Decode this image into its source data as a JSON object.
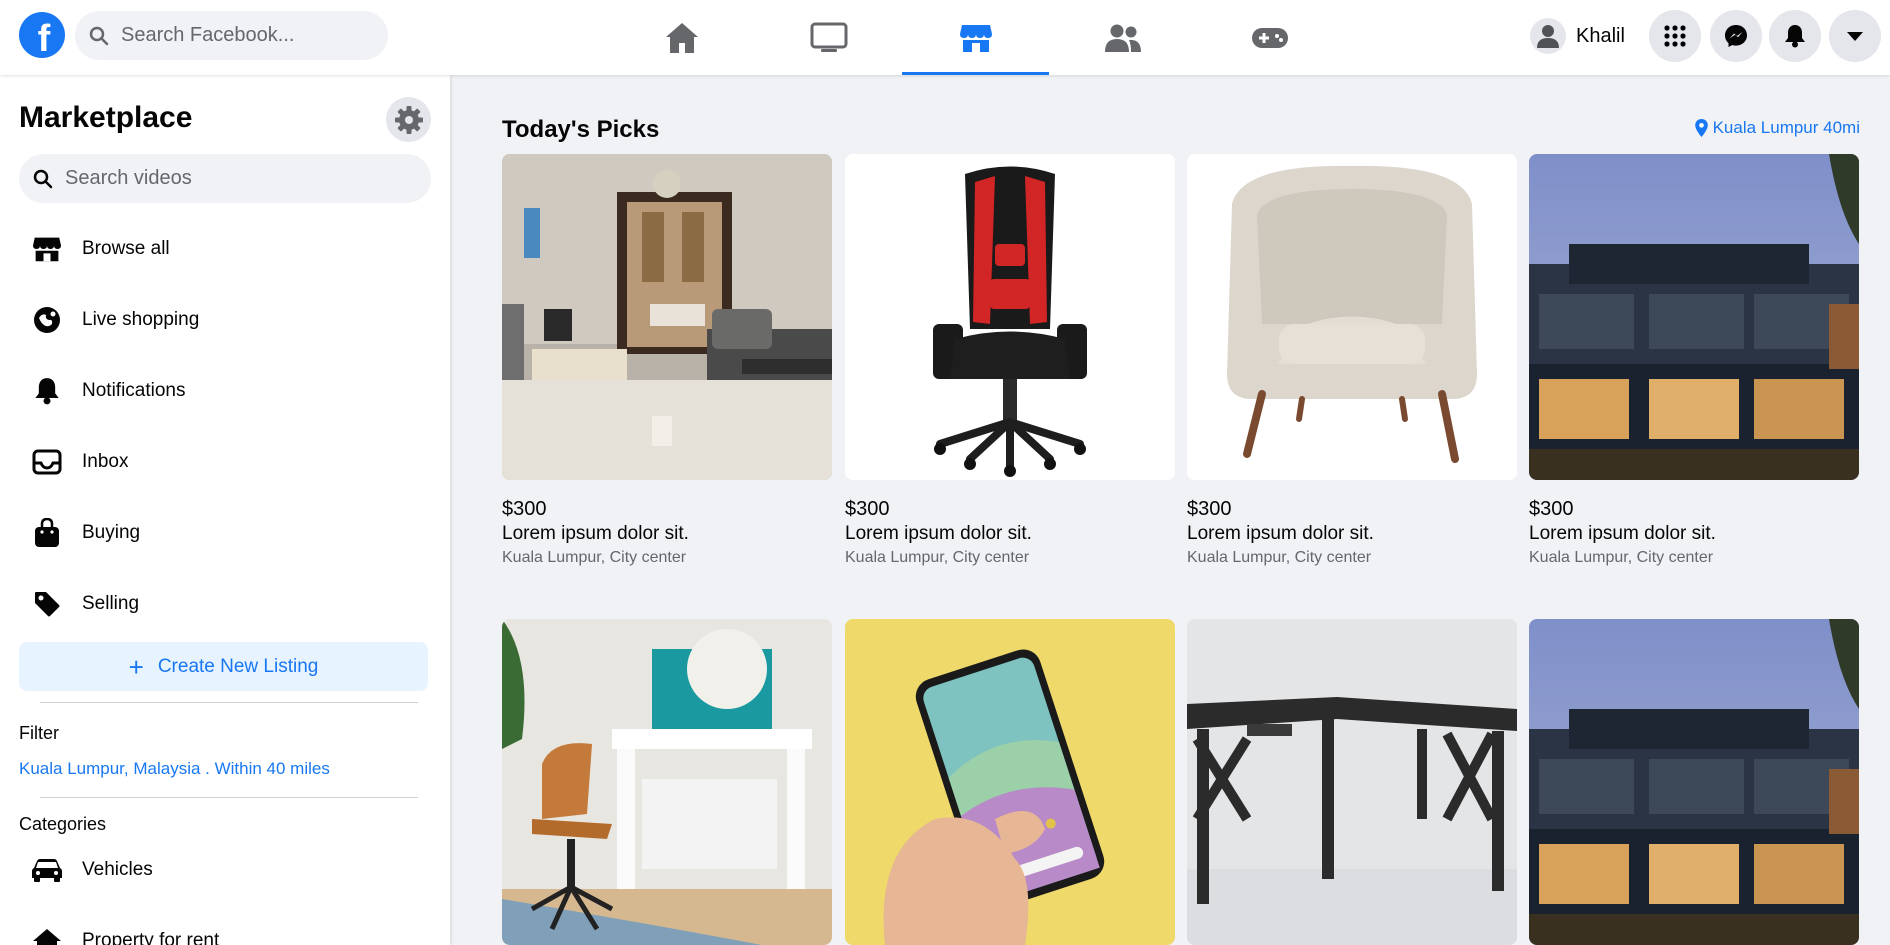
{
  "topbar": {
    "logo_letter": "f",
    "search_placeholder": "Search Facebook...",
    "nav_tabs": [
      {
        "name": "home",
        "icon": "home-icon",
        "active": false
      },
      {
        "name": "watch",
        "icon": "tv-icon",
        "active": false
      },
      {
        "name": "marketplace",
        "icon": "store-icon",
        "active": true
      },
      {
        "name": "groups",
        "icon": "people-icon",
        "active": false
      },
      {
        "name": "gaming",
        "icon": "gamepad-icon",
        "active": false
      }
    ],
    "user_name": "Khalil",
    "action_buttons": [
      "menu-grid-icon",
      "messenger-icon",
      "bell-icon",
      "caret-down-icon"
    ]
  },
  "sidebar": {
    "title": "Marketplace",
    "search_placeholder": "Search videos",
    "items": [
      {
        "label": "Browse all",
        "icon": "store-icon"
      },
      {
        "label": "Live shopping",
        "icon": "live-shopping-icon"
      },
      {
        "label": "Notifications",
        "icon": "bell-icon"
      },
      {
        "label": "Inbox",
        "icon": "inbox-icon"
      },
      {
        "label": "Buying",
        "icon": "shopping-bag-icon"
      },
      {
        "label": "Selling",
        "icon": "tag-icon"
      }
    ],
    "create_label": "Create New Listing",
    "filter_heading": "Filter",
    "filter_value": "Kuala Lumpur, Malaysia . Within 40 miles",
    "categories_heading": "Categories",
    "categories": [
      {
        "label": "Vehicles",
        "icon": "car-icon"
      },
      {
        "label": "Property for rent",
        "icon": "house-icon"
      }
    ]
  },
  "main": {
    "title": "Today's Picks",
    "location": "Kuala Lumpur 40mi",
    "listings": [
      {
        "price": "$300",
        "title": "Lorem ipsum dolor sit.",
        "location": "Kuala Lumpur, City center",
        "image": "apartment-interior"
      },
      {
        "price": "$300",
        "title": "Lorem ipsum dolor sit.",
        "location": "Kuala Lumpur, City center",
        "image": "gaming-chair"
      },
      {
        "price": "$300",
        "title": "Lorem ipsum dolor sit.",
        "location": "Kuala Lumpur, City center",
        "image": "armchair"
      },
      {
        "price": "$300",
        "title": "Lorem ipsum dolor sit.",
        "location": "Kuala Lumpur, City center",
        "image": "modern-house"
      },
      {
        "image": "desk-with-chair"
      },
      {
        "image": "smartphone-in-hand"
      },
      {
        "image": "corner-desk"
      },
      {
        "image": "modern-house"
      }
    ]
  },
  "colors": {
    "brand_blue": "#1877f2",
    "page_bg": "#f0f2f5",
    "light_blue": "#e7f3ff"
  }
}
